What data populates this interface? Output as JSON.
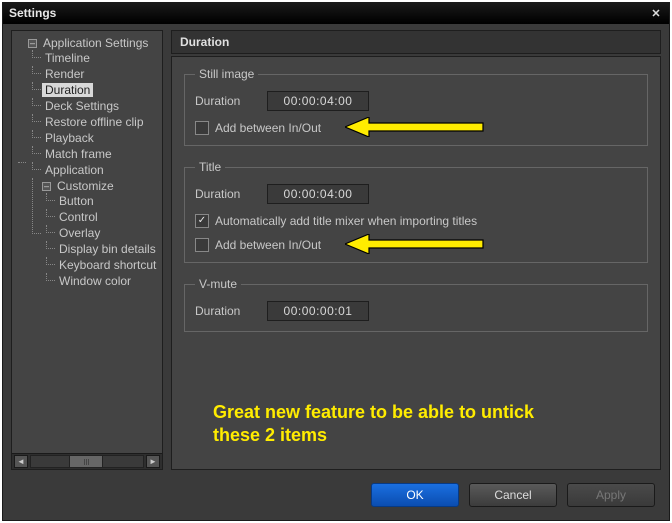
{
  "window": {
    "title": "Settings"
  },
  "tree": {
    "root": {
      "label": "Application Settings",
      "items": [
        {
          "label": "Timeline"
        },
        {
          "label": "Render"
        },
        {
          "label": "Duration",
          "selected": true
        },
        {
          "label": "Deck Settings"
        },
        {
          "label": "Restore offline clip"
        },
        {
          "label": "Playback"
        },
        {
          "label": "Match frame"
        },
        {
          "label": "Application"
        }
      ]
    },
    "customize": {
      "label": "Customize",
      "items": [
        {
          "label": "Button"
        },
        {
          "label": "Control"
        },
        {
          "label": "Overlay"
        },
        {
          "label": "Display bin details"
        },
        {
          "label": "Keyboard shortcut"
        },
        {
          "label": "Window color"
        }
      ]
    }
  },
  "panel": {
    "title": "Duration",
    "still": {
      "legend": "Still image",
      "duration_label": "Duration",
      "duration_value": "00:00:04:00",
      "add_between_label": "Add between In/Out",
      "add_between_checked": false
    },
    "title_grp": {
      "legend": "Title",
      "duration_label": "Duration",
      "duration_value": "00:00:04:00",
      "auto_add_label": "Automatically add title mixer when importing titles",
      "auto_add_checked": true,
      "add_between_label": "Add between In/Out",
      "add_between_checked": false
    },
    "vmute": {
      "legend": "V-mute",
      "duration_label": "Duration",
      "duration_value": "00:00:00:01"
    }
  },
  "annotation": {
    "text_line1": "Great new feature to be able to untick",
    "text_line2": "these 2 items",
    "arrow_color": "#ffec00"
  },
  "buttons": {
    "ok": "OK",
    "cancel": "Cancel",
    "apply": "Apply"
  }
}
